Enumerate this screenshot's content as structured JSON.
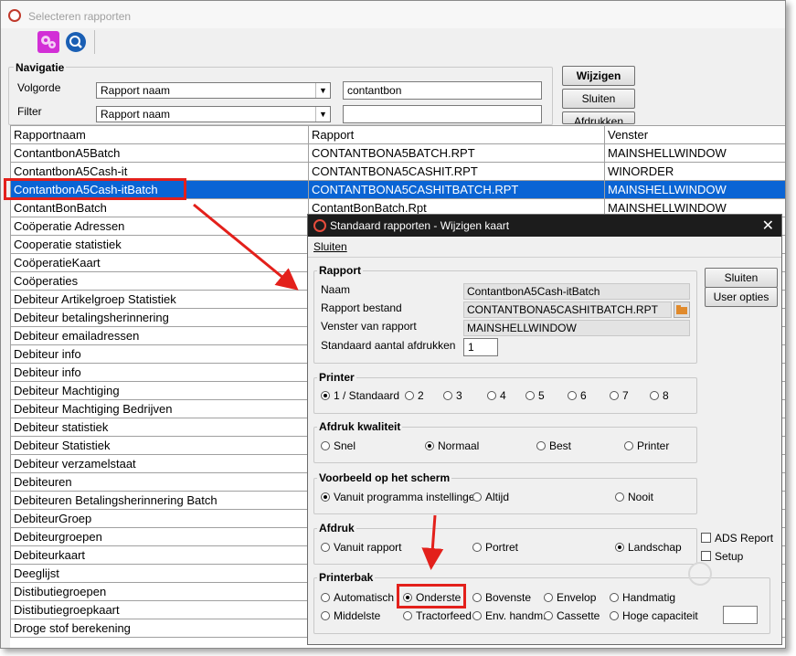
{
  "window": {
    "title": "Selecteren rapporten"
  },
  "navigation": {
    "title": "Navigatie",
    "volgorde_label": "Volgorde",
    "volgorde_value": "Rapport naam",
    "search_value": "contantbon",
    "filter_label": "Filter",
    "filter_value": "Rapport naam",
    "filter_text": ""
  },
  "buttons": {
    "wijzigen": "Wijzigen",
    "sluiten": "Sluiten",
    "afdrukken": "Afdrukken"
  },
  "table": {
    "headers": [
      "Rapportnaam",
      "Rapport",
      "Venster"
    ],
    "rows": [
      [
        "ContantbonA5Batch",
        "CONTANTBONA5BATCH.RPT",
        "MAINSHELLWINDOW"
      ],
      [
        "ContantbonA5Cash-it",
        "CONTANTBONA5CASHIT.RPT",
        "WINORDER"
      ],
      [
        "ContantbonA5Cash-itBatch",
        "CONTANTBONA5CASHITBATCH.RPT",
        "MAINSHELLWINDOW"
      ],
      [
        "ContantBonBatch",
        "ContantBonBatch.Rpt",
        "MAINSHELLWINDOW"
      ],
      [
        "Coöperatie Adressen",
        "",
        ""
      ],
      [
        "Cooperatie statistiek",
        "",
        ""
      ],
      [
        "CoöperatieKaart",
        "",
        ""
      ],
      [
        "Coöperaties",
        "",
        ""
      ],
      [
        "Debiteur Artikelgroep Statistiek",
        "",
        ""
      ],
      [
        "Debiteur betalingsherinnering",
        "",
        ""
      ],
      [
        "Debiteur emailadressen",
        "",
        ""
      ],
      [
        "Debiteur info",
        "",
        ""
      ],
      [
        "Debiteur info",
        "",
        ""
      ],
      [
        "Debiteur Machtiging",
        "",
        ""
      ],
      [
        "Debiteur Machtiging Bedrijven",
        "",
        ""
      ],
      [
        "Debiteur statistiek",
        "",
        ""
      ],
      [
        "Debiteur Statistiek",
        "",
        ""
      ],
      [
        "Debiteur verzamelstaat",
        "",
        ""
      ],
      [
        "Debiteuren",
        "",
        ""
      ],
      [
        "Debiteuren Betalingsherinnering Batch",
        "",
        ""
      ],
      [
        "DebiteurGroep",
        "",
        ""
      ],
      [
        "Debiteurgroepen",
        "",
        ""
      ],
      [
        "Debiteurkaart",
        "",
        ""
      ],
      [
        "Deeglijst",
        "",
        ""
      ],
      [
        "Distibutiegroepen",
        "",
        ""
      ],
      [
        "Distibutiegroepkaart",
        "",
        ""
      ],
      [
        "Droge stof berekening",
        "",
        ""
      ]
    ],
    "selected_index": 2
  },
  "dialog": {
    "title": "Standaard rapporten - Wijzigen kaart",
    "menu_sluiten": "Sluiten",
    "btn_sluiten": "Sluiten",
    "btn_user_opties": "User opties",
    "rapport": {
      "title": "Rapport",
      "naam_label": "Naam",
      "naam_value": "ContantbonA5Cash-itBatch",
      "bestand_label": "Rapport bestand",
      "bestand_value": "CONTANTBONA5CASHITBATCH.RPT",
      "venster_label": "Venster van rapport",
      "venster_value": "MAINSHELLWINDOW",
      "aantal_label": "Standaard aantal afdrukken",
      "aantal_value": "1"
    },
    "printer": {
      "title": "Printer",
      "options": [
        "1 / Standaard",
        "2",
        "3",
        "4",
        "5",
        "6",
        "7",
        "8"
      ],
      "selected": 0
    },
    "kwaliteit": {
      "title": "Afdruk kwaliteit",
      "options": [
        "Snel",
        "Normaal",
        "Best",
        "Printer"
      ],
      "selected": 1
    },
    "voorbeeld": {
      "title": "Voorbeeld op het scherm",
      "options": [
        "Vanuit programma instellingen",
        "Altijd",
        "Nooit"
      ],
      "selected": 0
    },
    "afdruk": {
      "title": "Afdruk",
      "options": [
        "Vanuit rapport",
        "Portret",
        "Landschap"
      ],
      "selected": 2
    },
    "ads_report": "ADS Report",
    "setup": "Setup",
    "printerbak": {
      "title": "Printerbak",
      "row1": [
        "Automatisch",
        "Onderste",
        "Bovenste",
        "Envelop",
        "Handmatig"
      ],
      "row2": [
        "Middelste",
        "Tractorfeed",
        "Env. handm.",
        "Cassette",
        "Hoge capaciteit"
      ],
      "selected": "Onderste"
    }
  },
  "colors": {
    "selection": "#0a64d4",
    "annotation": "#e3201b",
    "dialog_title": "#1c1c1c"
  }
}
